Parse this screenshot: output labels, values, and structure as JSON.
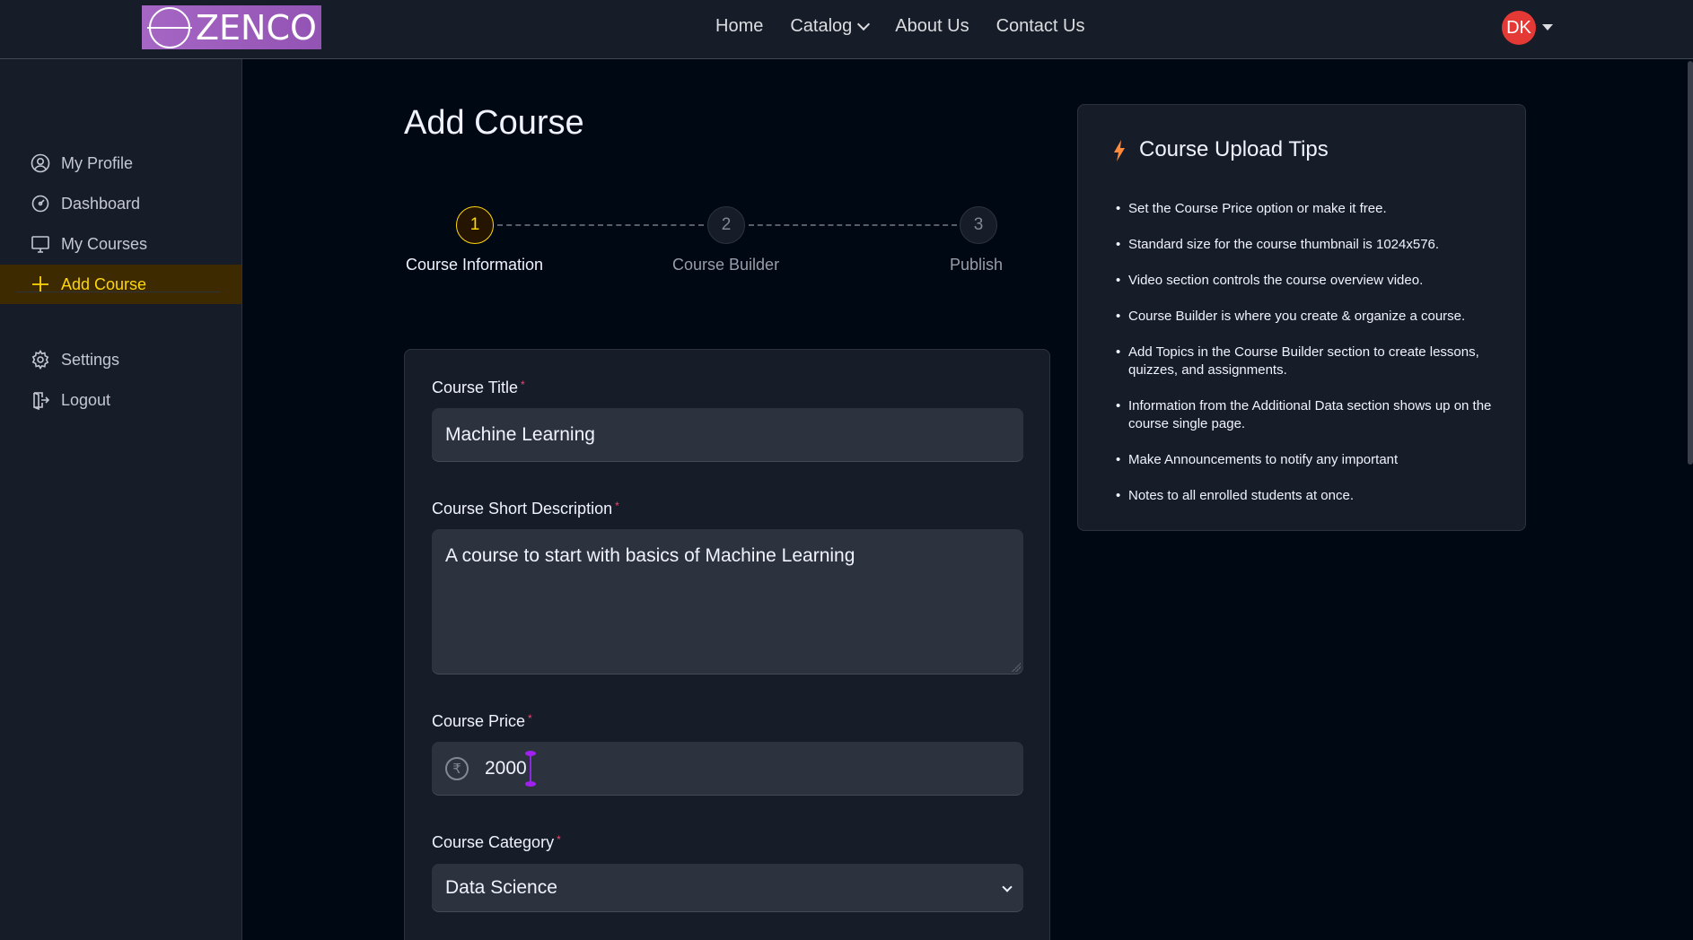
{
  "brand": {
    "logo_text": "ZENCO"
  },
  "nav": {
    "items": [
      "Home",
      "Catalog",
      "About Us",
      "Contact Us"
    ],
    "avatar_initials": "DK"
  },
  "sidebar": {
    "items": [
      {
        "label": "My Profile",
        "icon": "user-icon"
      },
      {
        "label": "Dashboard",
        "icon": "dashboard-icon"
      },
      {
        "label": "My Courses",
        "icon": "monitor-icon"
      },
      {
        "label": "Add Course",
        "icon": "plus-icon",
        "active": true
      }
    ],
    "bottom_items": [
      {
        "label": "Settings",
        "icon": "gear-icon"
      },
      {
        "label": "Logout",
        "icon": "logout-icon"
      }
    ]
  },
  "main": {
    "title": "Add Course",
    "steps": [
      {
        "number": "1",
        "label": "Course Information",
        "active": true
      },
      {
        "number": "2",
        "label": "Course Builder",
        "active": false
      },
      {
        "number": "3",
        "label": "Publish",
        "active": false
      }
    ],
    "form": {
      "title_label": "Course Title",
      "title_value": "Machine Learning",
      "desc_label": "Course Short Description",
      "desc_value": "A course to start with basics of Machine Learning",
      "price_label": "Course Price",
      "price_value": "2000",
      "price_currency_symbol": "₹",
      "category_label": "Course Category",
      "category_value": "Data Science",
      "required_mark": "*"
    }
  },
  "tips": {
    "title": "Course Upload Tips",
    "items": [
      "Set the Course Price option or make it free.",
      "Standard size for the course thumbnail is 1024x576.",
      "Video section controls the course overview video.",
      "Course Builder is where you create & organize a course.",
      "Add Topics in the Course Builder section to create lessons, quizzes, and assignments.",
      "Information from the Additional Data section shows up on the course single page.",
      "Make Announcements to notify any important",
      "Notes to all enrolled students at once."
    ]
  },
  "colors": {
    "accent": "#ffd60a",
    "background": "#000814",
    "panel": "#161d29",
    "avatar": "#e53935",
    "required": "#ef476f",
    "tips_icon": "#ff8a3d"
  }
}
